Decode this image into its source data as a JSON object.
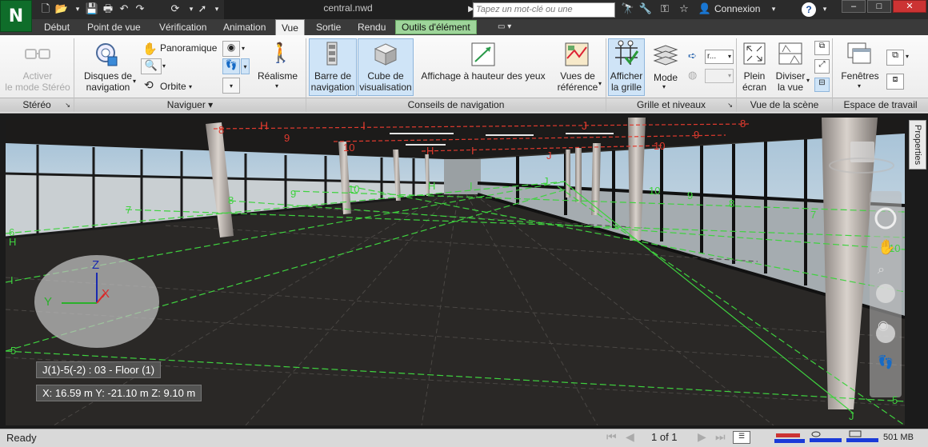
{
  "app": {
    "document_title": "central.nwd",
    "search_placeholder": "Tapez un mot-clé ou une expression",
    "login": "Connexion",
    "help": "?"
  },
  "tabs": [
    {
      "label": "Début"
    },
    {
      "label": "Point de vue"
    },
    {
      "label": "Vérification"
    },
    {
      "label": "Animation"
    },
    {
      "label": "Vue"
    },
    {
      "label": "Sortie"
    },
    {
      "label": "Rendu"
    },
    {
      "label": "Outils d'élément"
    }
  ],
  "ribbon": {
    "stereo": {
      "button1": "Activer",
      "button2": "le mode Stéréo",
      "panel": "Stéréo"
    },
    "naviguer": {
      "disques1": "Disques de",
      "disques2": "navigation",
      "panoramique": "Panoramique",
      "orbite": "Orbite",
      "realisme": "Réalisme",
      "panel": "Naviguer ▾"
    },
    "conseils": {
      "barre1": "Barre de",
      "barre2": "navigation",
      "cube1": "Cube de",
      "cube2": "visualisation",
      "hauteur": "Affichage à hauteur des yeux",
      "vues1": "Vues de",
      "vues2": "référence",
      "panel": "Conseils de navigation"
    },
    "grille": {
      "afficher1": "Afficher",
      "afficher2": "la grille",
      "mode": "Mode",
      "dropdown": "r...",
      "panel": "Grille et niveaux"
    },
    "scene": {
      "plein1": "Plein",
      "plein2": "écran",
      "diviser1": "Diviser",
      "diviser2": "la vue",
      "panel": "Vue de la scène"
    },
    "espace": {
      "fenetres": "Fenêtres",
      "panel": "Espace de travail"
    }
  },
  "viewport": {
    "properties_tab": "Properties",
    "level_info": "J(1)-5(-2) : 03 - Floor (1)",
    "coords": "X: 16.59 m  Y: -21.10 m  Z: 9.10 m",
    "axis": {
      "z": "Z",
      "x": "X",
      "y": "Y"
    },
    "grid_labels_red": [
      "8",
      "H",
      "I",
      "J",
      "8",
      "9",
      "10",
      "H",
      "I",
      "J",
      "9",
      "10"
    ],
    "grid_labels_green": [
      "7",
      "6",
      "H",
      "8",
      "9",
      "10",
      "H",
      "I",
      "J",
      "10",
      "9",
      "8",
      "7",
      "I",
      "5",
      "5",
      "J",
      "10"
    ]
  },
  "status": {
    "ready": "Ready",
    "page": "1 of 1",
    "memory": "501 MB"
  },
  "colors": {
    "accent_green": "#0f6d2a",
    "context_tab": "#9ed59a",
    "grid_green": "#3fd23f",
    "grid_red": "#e03a2e"
  }
}
